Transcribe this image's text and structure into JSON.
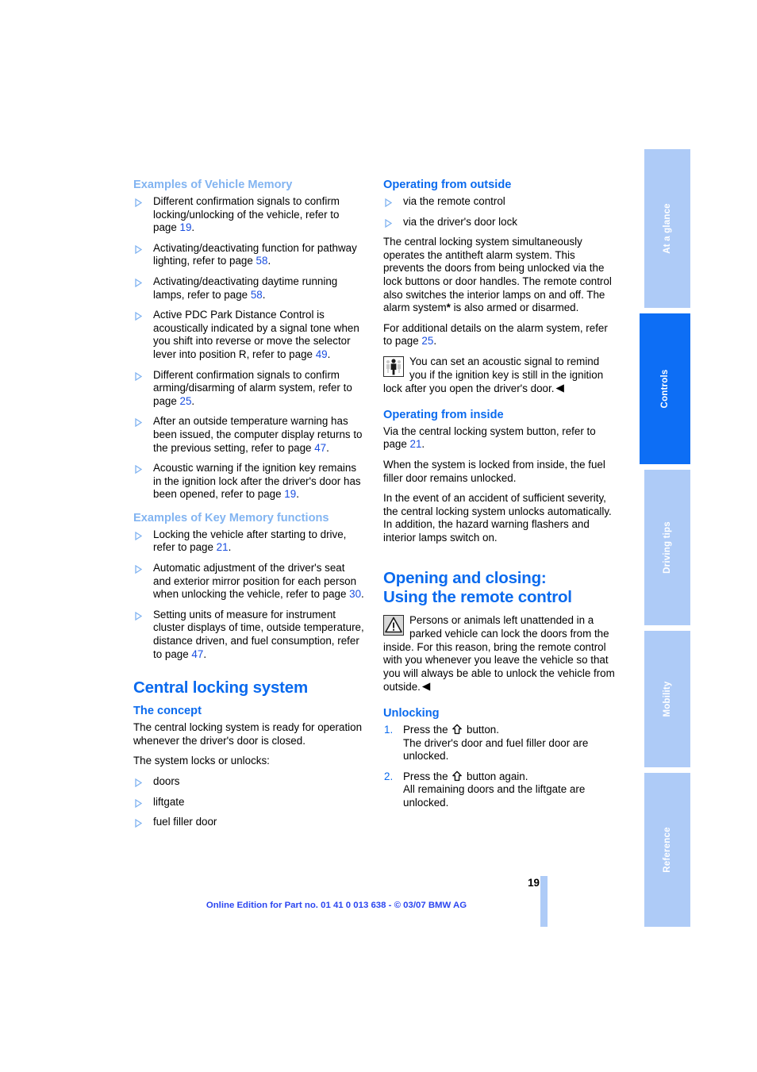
{
  "page": {
    "number": "19",
    "footer_text": "Online Edition for Part no. 01 41 0 013 638 - © 03/07 BMW AG"
  },
  "colors": {
    "heading_blue": "#0a6aee",
    "pale_blue": "#82b4f1",
    "tab_blue": "#aecbf7",
    "tab_active_blue": "#0d6ef5",
    "page_ref_blue": "#1a4fe0",
    "footer_blue": "#2b46f0"
  },
  "tabs": [
    {
      "label": "At a glance",
      "active": false
    },
    {
      "label": "Controls",
      "active": true
    },
    {
      "label": "Driving tips",
      "active": false
    },
    {
      "label": "Mobility",
      "active": false
    },
    {
      "label": "Reference",
      "active": false
    }
  ],
  "left_column": {
    "vehicle_memory": {
      "heading": "Examples of Vehicle Memory",
      "items": [
        {
          "text_before": "Different confirmation signals to confirm locking/unlocking of the vehicle, refer to page ",
          "page": "19",
          "text_after": "."
        },
        {
          "text_before": "Activating/deactivating function for pathway lighting, refer to page ",
          "page": "58",
          "text_after": "."
        },
        {
          "text_before": "Activating/deactivating daytime running lamps, refer to page ",
          "page": "58",
          "text_after": "."
        },
        {
          "text_before": "Active PDC Park Distance Control is acoustically indicated by a signal tone when you shift into reverse or move the selector lever into position R, refer to page ",
          "page": "49",
          "text_after": "."
        },
        {
          "text_before": "Different confirmation signals to confirm arming/disarming of alarm system, refer to page ",
          "page": "25",
          "text_after": "."
        },
        {
          "text_before": "After an outside temperature warning has been issued, the computer display returns to the previous setting, refer to page ",
          "page": "47",
          "text_after": "."
        },
        {
          "text_before": "Acoustic warning if the ignition key remains in the ignition lock after the driver's door has been opened, refer to page ",
          "page": "19",
          "text_after": "."
        }
      ]
    },
    "key_memory": {
      "heading": "Examples of Key Memory functions",
      "items": [
        {
          "text_before": "Locking the vehicle after starting to drive, refer to page ",
          "page": "21",
          "text_after": "."
        },
        {
          "text_before": "Automatic adjustment of the driver's seat and exterior mirror position for each person when unlocking the vehicle, refer to page ",
          "page": "30",
          "text_after": "."
        },
        {
          "text_before": "Setting units of measure for instrument cluster displays of time, outside temperature, distance driven, and fuel consumption, refer to page ",
          "page": "47",
          "text_after": "."
        }
      ]
    },
    "central_locking": {
      "title": "Central locking system",
      "concept_heading": "The concept",
      "concept_para1": "The central locking system is ready for operation whenever the driver's door is closed.",
      "concept_para2": "The system locks or unlocks:",
      "concept_items": [
        "doors",
        "liftgate",
        "fuel filler door"
      ]
    }
  },
  "right_column": {
    "operating_outside": {
      "heading": "Operating from outside",
      "items": [
        "via the remote control",
        "via the driver's door lock"
      ],
      "para1": "The central locking system simultaneously operates the antitheft alarm system. This prevents the doors from being unlocked via the lock buttons or door handles. The remote control also switches the interior lamps on and off. The alarm system",
      "para1_star": "*",
      "para1_tail": " is also armed or disarmed.",
      "para2_before": "For additional details on the alarm system, refer to page ",
      "para2_page": "25",
      "para2_after": ".",
      "notice": "You can set an acoustic signal to remind you if the ignition key is still in the ignition lock after you open the driver's door.",
      "notice_end": "◀"
    },
    "operating_inside": {
      "heading": "Operating from inside",
      "para1_before": "Via the central locking system button, refer to page ",
      "para1_page": "21",
      "para1_after": ".",
      "para2": "When the system is locked from inside, the fuel filler door remains unlocked.",
      "para3": "In the event of an accident of sufficient severity, the central locking system unlocks automatically. In addition, the hazard warning flashers and interior lamps switch on."
    },
    "opening_closing": {
      "title_line1": "Opening and closing:",
      "title_line2": "Using the remote control",
      "warning": "Persons or animals left unattended in a parked vehicle can lock the doors from the inside. For this reason, bring the remote control with you whenever you leave the vehicle so that you will always be able to unlock the vehicle from outside.",
      "warning_end": "◀",
      "unlocking_heading": "Unlocking",
      "steps": [
        {
          "num": "1.",
          "before": "Press the ",
          "glyph": "unlock-arrow-icon",
          "after": " button.",
          "detail": "The driver's door and fuel filler door are unlocked."
        },
        {
          "num": "2.",
          "before": "Press the ",
          "glyph": "unlock-arrow-icon",
          "after": " button again.",
          "detail": "All remaining doors and the liftgate are unlocked."
        }
      ]
    }
  }
}
